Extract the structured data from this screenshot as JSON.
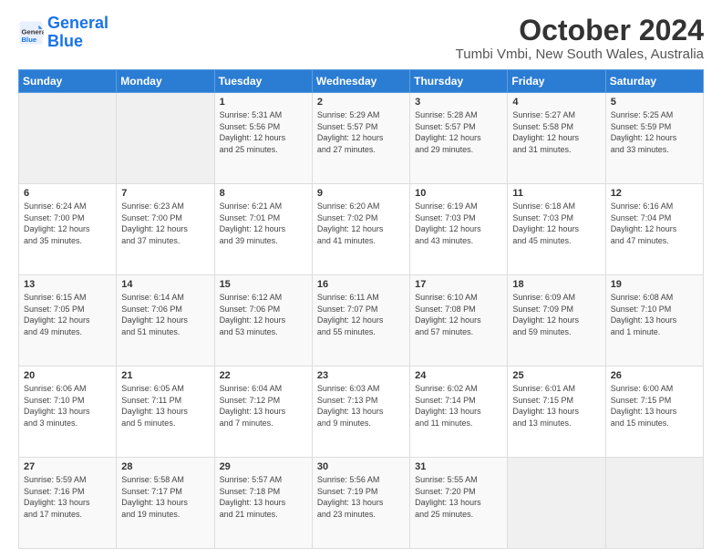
{
  "logo": {
    "line1": "General",
    "line2": "Blue"
  },
  "title": "October 2024",
  "subtitle": "Tumbi Vmbi, New South Wales, Australia",
  "header": {
    "days": [
      "Sunday",
      "Monday",
      "Tuesday",
      "Wednesday",
      "Thursday",
      "Friday",
      "Saturday"
    ]
  },
  "weeks": [
    [
      {
        "num": "",
        "info": ""
      },
      {
        "num": "",
        "info": ""
      },
      {
        "num": "1",
        "info": "Sunrise: 5:31 AM\nSunset: 5:56 PM\nDaylight: 12 hours\nand 25 minutes."
      },
      {
        "num": "2",
        "info": "Sunrise: 5:29 AM\nSunset: 5:57 PM\nDaylight: 12 hours\nand 27 minutes."
      },
      {
        "num": "3",
        "info": "Sunrise: 5:28 AM\nSunset: 5:57 PM\nDaylight: 12 hours\nand 29 minutes."
      },
      {
        "num": "4",
        "info": "Sunrise: 5:27 AM\nSunset: 5:58 PM\nDaylight: 12 hours\nand 31 minutes."
      },
      {
        "num": "5",
        "info": "Sunrise: 5:25 AM\nSunset: 5:59 PM\nDaylight: 12 hours\nand 33 minutes."
      }
    ],
    [
      {
        "num": "6",
        "info": "Sunrise: 6:24 AM\nSunset: 7:00 PM\nDaylight: 12 hours\nand 35 minutes."
      },
      {
        "num": "7",
        "info": "Sunrise: 6:23 AM\nSunset: 7:00 PM\nDaylight: 12 hours\nand 37 minutes."
      },
      {
        "num": "8",
        "info": "Sunrise: 6:21 AM\nSunset: 7:01 PM\nDaylight: 12 hours\nand 39 minutes."
      },
      {
        "num": "9",
        "info": "Sunrise: 6:20 AM\nSunset: 7:02 PM\nDaylight: 12 hours\nand 41 minutes."
      },
      {
        "num": "10",
        "info": "Sunrise: 6:19 AM\nSunset: 7:03 PM\nDaylight: 12 hours\nand 43 minutes."
      },
      {
        "num": "11",
        "info": "Sunrise: 6:18 AM\nSunset: 7:03 PM\nDaylight: 12 hours\nand 45 minutes."
      },
      {
        "num": "12",
        "info": "Sunrise: 6:16 AM\nSunset: 7:04 PM\nDaylight: 12 hours\nand 47 minutes."
      }
    ],
    [
      {
        "num": "13",
        "info": "Sunrise: 6:15 AM\nSunset: 7:05 PM\nDaylight: 12 hours\nand 49 minutes."
      },
      {
        "num": "14",
        "info": "Sunrise: 6:14 AM\nSunset: 7:06 PM\nDaylight: 12 hours\nand 51 minutes."
      },
      {
        "num": "15",
        "info": "Sunrise: 6:12 AM\nSunset: 7:06 PM\nDaylight: 12 hours\nand 53 minutes."
      },
      {
        "num": "16",
        "info": "Sunrise: 6:11 AM\nSunset: 7:07 PM\nDaylight: 12 hours\nand 55 minutes."
      },
      {
        "num": "17",
        "info": "Sunrise: 6:10 AM\nSunset: 7:08 PM\nDaylight: 12 hours\nand 57 minutes."
      },
      {
        "num": "18",
        "info": "Sunrise: 6:09 AM\nSunset: 7:09 PM\nDaylight: 12 hours\nand 59 minutes."
      },
      {
        "num": "19",
        "info": "Sunrise: 6:08 AM\nSunset: 7:10 PM\nDaylight: 13 hours\nand 1 minute."
      }
    ],
    [
      {
        "num": "20",
        "info": "Sunrise: 6:06 AM\nSunset: 7:10 PM\nDaylight: 13 hours\nand 3 minutes."
      },
      {
        "num": "21",
        "info": "Sunrise: 6:05 AM\nSunset: 7:11 PM\nDaylight: 13 hours\nand 5 minutes."
      },
      {
        "num": "22",
        "info": "Sunrise: 6:04 AM\nSunset: 7:12 PM\nDaylight: 13 hours\nand 7 minutes."
      },
      {
        "num": "23",
        "info": "Sunrise: 6:03 AM\nSunset: 7:13 PM\nDaylight: 13 hours\nand 9 minutes."
      },
      {
        "num": "24",
        "info": "Sunrise: 6:02 AM\nSunset: 7:14 PM\nDaylight: 13 hours\nand 11 minutes."
      },
      {
        "num": "25",
        "info": "Sunrise: 6:01 AM\nSunset: 7:15 PM\nDaylight: 13 hours\nand 13 minutes."
      },
      {
        "num": "26",
        "info": "Sunrise: 6:00 AM\nSunset: 7:15 PM\nDaylight: 13 hours\nand 15 minutes."
      }
    ],
    [
      {
        "num": "27",
        "info": "Sunrise: 5:59 AM\nSunset: 7:16 PM\nDaylight: 13 hours\nand 17 minutes."
      },
      {
        "num": "28",
        "info": "Sunrise: 5:58 AM\nSunset: 7:17 PM\nDaylight: 13 hours\nand 19 minutes."
      },
      {
        "num": "29",
        "info": "Sunrise: 5:57 AM\nSunset: 7:18 PM\nDaylight: 13 hours\nand 21 minutes."
      },
      {
        "num": "30",
        "info": "Sunrise: 5:56 AM\nSunset: 7:19 PM\nDaylight: 13 hours\nand 23 minutes."
      },
      {
        "num": "31",
        "info": "Sunrise: 5:55 AM\nSunset: 7:20 PM\nDaylight: 13 hours\nand 25 minutes."
      },
      {
        "num": "",
        "info": ""
      },
      {
        "num": "",
        "info": ""
      }
    ]
  ]
}
